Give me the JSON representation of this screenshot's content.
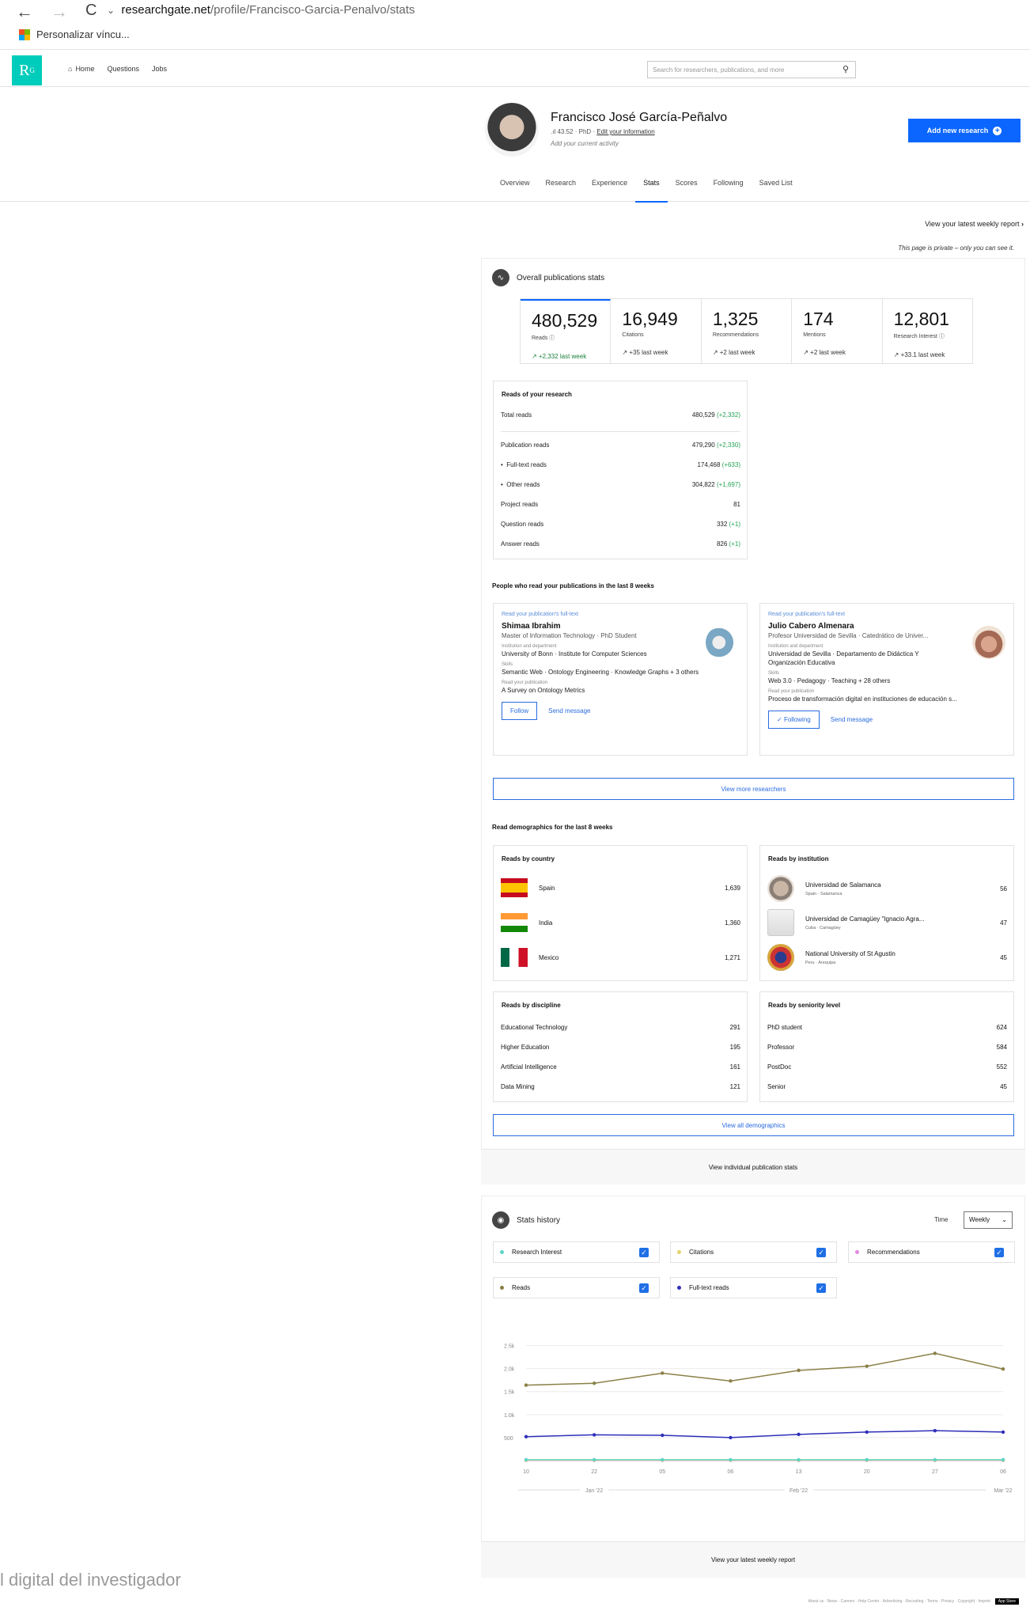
{
  "browser": {
    "back": "←",
    "forward": "→",
    "reload": "C",
    "url_domain": "researchgate.net",
    "url_path": "/profile/Francisco-Garcia-Penalvo/stats",
    "bookmark": "Personalizar víncu..."
  },
  "topbar": {
    "logo": "R",
    "logo_sup": "G",
    "nav": [
      "Home",
      "Questions",
      "Jobs"
    ],
    "search_placeholder": "Search for researchers, publications, and more"
  },
  "profile": {
    "name": "Francisco José García-Peñalvo",
    "score": "43.52",
    "degree": "PhD",
    "edit": "Edit your information",
    "activity": "Add your current activity",
    "add_button": "Add new research",
    "tabs": [
      "Overview",
      "Research",
      "Experience",
      "Stats",
      "Scores",
      "Following",
      "Saved List"
    ],
    "active_tab": "Stats"
  },
  "main": {
    "weekly_link": "View your latest weekly report",
    "private_note": "This page is private – only you can see it.",
    "overall_title": "Overall publications stats",
    "stats": [
      {
        "num": "480,529",
        "label": "Reads",
        "change": "+2,332 last week"
      },
      {
        "num": "16,949",
        "label": "Citations",
        "change": "+35 last week"
      },
      {
        "num": "1,325",
        "label": "Recommendations",
        "change": "+2 last week"
      },
      {
        "num": "174",
        "label": "Mentions",
        "change": "+2 last week"
      },
      {
        "num": "12,801",
        "label": "Research Interest",
        "change": "+33.1 last week"
      }
    ],
    "reads_title": "Reads of your research",
    "reads": [
      {
        "label": "Total reads",
        "value": "480,529",
        "delta": "(+2,332)"
      },
      {
        "label": "Publication reads",
        "value": "479,290",
        "delta": "(+2,330)"
      },
      {
        "label": "Full-text reads",
        "value": "174,468",
        "delta": "(+633)"
      },
      {
        "label": "Other reads",
        "value": "304,822",
        "delta": "(+1,697)"
      },
      {
        "label": "Project reads",
        "value": "81",
        "delta": ""
      },
      {
        "label": "Question reads",
        "value": "332",
        "delta": "(+1)"
      },
      {
        "label": "Answer reads",
        "value": "826",
        "delta": "(+1)"
      }
    ],
    "people_title": "People who read your publications in the last 8 weeks",
    "people": [
      {
        "top": "Read your publication's full-text",
        "name": "Shimaa Ibrahim",
        "role": "Master of Information Technology · PhD Student",
        "inst_k": "Institution and department",
        "inst": "University of Bonn · Institute for Computer Sciences",
        "skills_k": "Skills",
        "skills": "Semantic Web · Ontology Engineering · Knowledge Graphs + 3 others",
        "pub_k": "Read your publication",
        "pub": "A Survey on Ontology Metrics",
        "btn1": "Follow",
        "btn2": "Send message"
      },
      {
        "top": "Read your publication's full-text",
        "name": "Julio Cabero Almenara",
        "role": "Profesor Universidad de Sevilla · Catedrático de Univer...",
        "inst_k": "Institution and department",
        "inst": "Universidad de Sevilla · Departamento de Didáctica Y",
        "inst2": "Organización Educativa",
        "skills_k": "Skills",
        "skills": "Web 3.0 · Pedagogy · Teaching + 28 others",
        "pub_k": "Read your publication",
        "pub": "Proceso de transformación digital en instituciones de educación s...",
        "btn1": "Following",
        "btn2": "Send message"
      }
    ],
    "more_researchers": "View more researchers",
    "demo_title": "Read demographics for the last 8 weeks",
    "country_title": "Reads by country",
    "countries": [
      {
        "name": "Spain",
        "value": "1,639"
      },
      {
        "name": "India",
        "value": "1,360"
      },
      {
        "name": "Mexico",
        "value": "1,271"
      }
    ],
    "inst_title": "Reads by institution",
    "institutions": [
      {
        "name": "Universidad de Salamanca",
        "sub": "Spain · Salamanca",
        "value": "56"
      },
      {
        "name": "Universidad de Camagüey \"Ignacio Agra...",
        "sub": "Cuba · Camagüey",
        "value": "47"
      },
      {
        "name": "National University of St Agustin",
        "sub": "Peru · Arequipa",
        "value": "45"
      }
    ],
    "discipline_title": "Reads by discipline",
    "disciplines": [
      {
        "name": "Educational Technology",
        "value": "291"
      },
      {
        "name": "Higher Education",
        "value": "195"
      },
      {
        "name": "Artificial Intelligence",
        "value": "161"
      },
      {
        "name": "Data Mining",
        "value": "121"
      }
    ],
    "seniority_title": "Reads by seniority level",
    "seniority": [
      {
        "name": "PhD student",
        "value": "624"
      },
      {
        "name": "Professor",
        "value": "584"
      },
      {
        "name": "PostDoc",
        "value": "552"
      },
      {
        "name": "Senior",
        "value": "45"
      }
    ],
    "all_demo": "View all demographics",
    "pub_stats": "View individual publication stats"
  },
  "history": {
    "title": "Stats history",
    "time_label": "Time",
    "time_value": "Weekly",
    "legend": [
      {
        "name": "Research Interest",
        "color": "#5fd3c8"
      },
      {
        "name": "Citations",
        "color": "#e4d36b"
      },
      {
        "name": "Recommendations",
        "color": "#e58ae0"
      },
      {
        "name": "Reads",
        "color": "#8a8046"
      },
      {
        "name": "Full-text reads",
        "color": "#2e2fb8"
      }
    ],
    "footer": "View your latest weekly report"
  },
  "chart_data": {
    "type": "line",
    "x": [
      "10",
      "22",
      "05",
      "06",
      "13",
      "20",
      "27",
      "06"
    ],
    "month_labels": [
      "Jan '22",
      "Feb '22",
      "Mar '22"
    ],
    "y_ticks": [
      "2.5k",
      "2.0k",
      "1.5k",
      "1.0k",
      "500"
    ],
    "ylim": [
      0,
      2750
    ],
    "series": [
      {
        "name": "Reads",
        "color": "#8a8046",
        "values": [
          1640,
          1680,
          1900,
          1730,
          1960,
          2050,
          2330,
          1990
        ]
      },
      {
        "name": "Full-text reads",
        "color": "#2e2fb8",
        "values": [
          520,
          560,
          550,
          500,
          570,
          620,
          650,
          620
        ]
      },
      {
        "name": "Research Interest",
        "color": "#5fd3c8",
        "values": [
          20,
          20,
          20,
          20,
          20,
          20,
          20,
          20
        ]
      },
      {
        "name": "Citations",
        "color": "#e4d36b",
        "values": [
          10,
          10,
          10,
          10,
          10,
          10,
          10,
          10
        ]
      },
      {
        "name": "Recommendations",
        "color": "#e58ae0",
        "values": [
          5,
          5,
          5,
          5,
          5,
          5,
          5,
          5
        ]
      }
    ]
  },
  "caption": "l digital del investigador",
  "footer_links": "About us · News · Careers · Help Center · Advertising · Recruiting · Terms · Privacy · Copyright · Imprint",
  "app_store": "App Store"
}
